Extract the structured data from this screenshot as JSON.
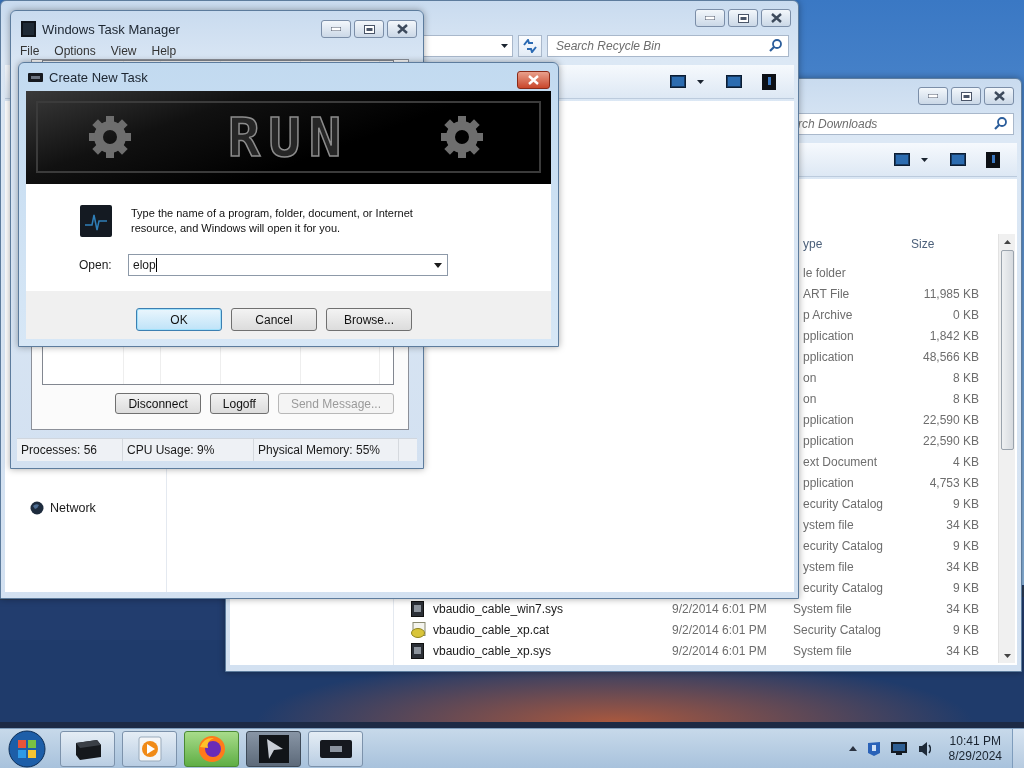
{
  "downloads_window": {
    "search": {
      "placeholder": "rch Downloads"
    },
    "columns": [
      "ype",
      "Size"
    ],
    "rows": [
      {
        "type": "le folder"
      },
      {
        "type": "ART File",
        "size": "11,985 KB"
      },
      {
        "type": "p Archive",
        "size": "0 KB"
      },
      {
        "type": "pplication",
        "size": "1,842 KB"
      },
      {
        "type": "pplication",
        "size": "48,566 KB"
      },
      {
        "type": "on",
        "size": "8 KB"
      },
      {
        "type": "on",
        "size": "8 KB"
      },
      {
        "type": "pplication",
        "size": "22,590 KB"
      },
      {
        "type": "pplication",
        "size": "22,590 KB"
      },
      {
        "type": "ext Document",
        "size": "4 KB"
      },
      {
        "type": "pplication",
        "size": "4,753 KB"
      },
      {
        "type": "ecurity Catalog",
        "size": "9 KB"
      },
      {
        "type": "ystem file",
        "size": "34 KB"
      },
      {
        "type": "ecurity Catalog",
        "size": "9 KB"
      },
      {
        "type": "ystem file",
        "size": "34 KB"
      },
      {
        "type": "ecurity Catalog",
        "size": "9 KB"
      },
      {
        "kind": "sys",
        "name": "vbaudio_cable_win7.sys",
        "date": "9/2/2014 6:01 PM",
        "type": "System file",
        "size": "34 KB"
      },
      {
        "kind": "cat",
        "name": "vbaudio_cable_xp.cat",
        "date": "9/2/2014 6:01 PM",
        "type": "Security Catalog",
        "size": "9 KB"
      },
      {
        "kind": "sys",
        "name": "vbaudio_cable_xp.sys",
        "date": "9/2/2014 6:01 PM",
        "type": "System file",
        "size": "34 KB"
      }
    ]
  },
  "recycle_bin_window": {
    "search": {
      "placeholder": "Search Recycle Bin"
    },
    "nav": [
      {
        "label": "Network"
      }
    ]
  },
  "task_manager": {
    "title": "Windows Task Manager",
    "menu": [
      "File",
      "Options",
      "View",
      "Help"
    ],
    "buttons": [
      {
        "label": "Disconnect",
        "disabled": false
      },
      {
        "label": "Logoff",
        "disabled": false
      },
      {
        "label": "Send Message...",
        "disabled": true
      }
    ],
    "status": [
      "Processes: 56",
      "CPU Usage: 9%",
      "Physical Memory: 55%"
    ]
  },
  "create_new_task": {
    "title": "Create New Task",
    "banner": "RUN",
    "message": "Type the name of a program, folder, document, or Internet resource, and Windows will open it for you.",
    "open_label": "Open:",
    "open_value": "elop",
    "buttons": [
      {
        "label": "OK",
        "default": true
      },
      {
        "label": "Cancel",
        "default": false
      },
      {
        "label": "Browse...",
        "default": false
      }
    ]
  },
  "taskbar": {
    "clock": {
      "time": "10:41 PM",
      "date": "8/29/2024"
    }
  }
}
